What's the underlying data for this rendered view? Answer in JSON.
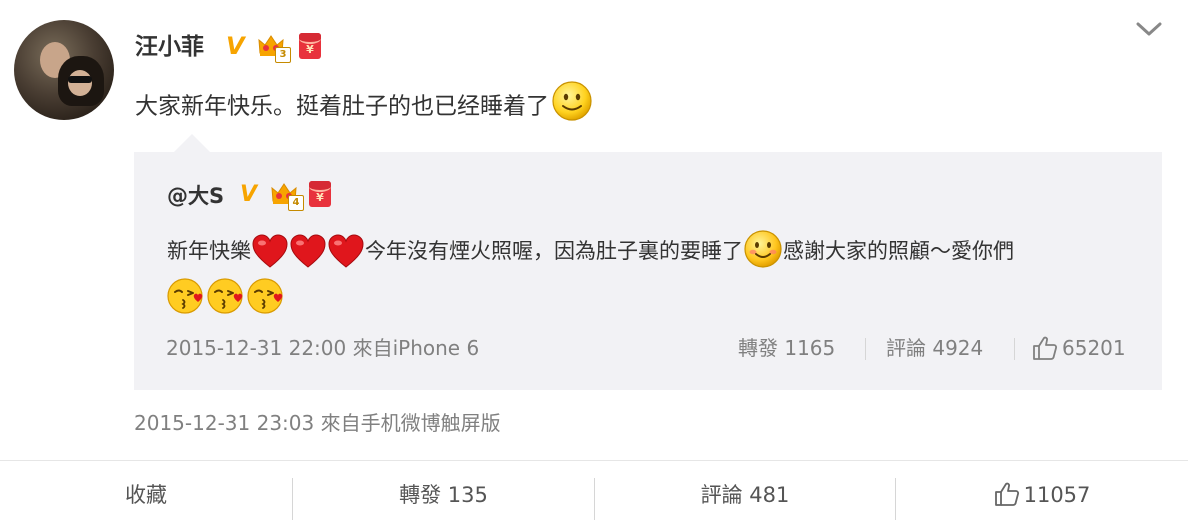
{
  "post": {
    "username": "汪小菲",
    "text": "大家新年快乐。挺着肚子的也已经睡着了",
    "timestamp_source": "2015-12-31 23:03 來自手机微博触屏版"
  },
  "repost": {
    "username": "@大S",
    "text_part1": "新年快樂",
    "text_part2": "今年沒有煙火照喔，因為肚子裏的要睡了",
    "text_part3": "感謝大家的照顧～愛你們",
    "timestamp_source": "2015-12-31 22:00 來自iPhone 6",
    "forward": "轉發 1165",
    "comment": "評論 4924",
    "likes": "65201"
  },
  "badges": {
    "verified": "V",
    "crown_level_main": "3",
    "crown_level_repost": "4",
    "red_envelope": "¥"
  },
  "actions": {
    "favorite": "收藏",
    "forward": "轉發 135",
    "comment": "評論 481",
    "likes": "11057"
  },
  "icons": {
    "menu": "chevron-down-icon",
    "like": "thumbs-up-icon",
    "smile": "smile-emoji",
    "heart": "heart-emoji",
    "kiss": "kiss-emoji",
    "crown": "crown-icon",
    "red_envelope": "red-envelope-icon"
  },
  "colors": {
    "accent_orange": "#f7a400",
    "red_envelope": "#e8323c",
    "repost_bg": "#f2f2f5",
    "meta_gray": "#808080"
  }
}
